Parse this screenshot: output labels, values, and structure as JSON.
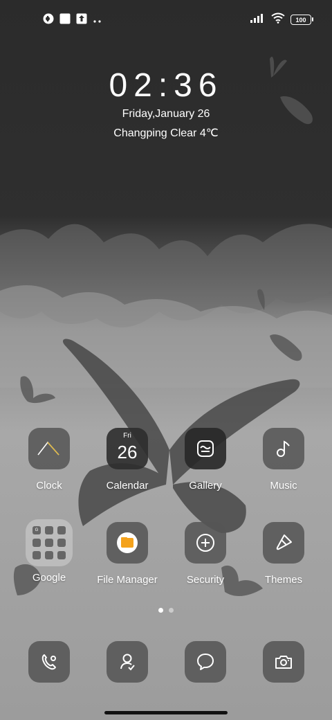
{
  "status_bar": {
    "left_icons": [
      "notification-app-icon",
      "notification-square-icon",
      "notification-upload-icon",
      "more-notifications-icon"
    ],
    "right_icons": [
      "signal-icon",
      "wifi-icon",
      "battery-icon"
    ],
    "battery_level": "100"
  },
  "clock_widget": {
    "time": "02:36",
    "date": "Friday,January 26",
    "weather": "Changping Clear 4℃"
  },
  "apps": [
    {
      "label": "Clock",
      "icon": "clock-icon"
    },
    {
      "label": "Calendar",
      "icon": "calendar-icon",
      "day": "Fri",
      "date": "26"
    },
    {
      "label": "Gallery",
      "icon": "gallery-icon"
    },
    {
      "label": "Music",
      "icon": "music-icon"
    },
    {
      "label": "Google",
      "icon": "folder-icon"
    },
    {
      "label": "File Manager",
      "icon": "file-manager-icon"
    },
    {
      "label": "Security",
      "icon": "security-icon"
    },
    {
      "label": "Themes",
      "icon": "themes-icon"
    }
  ],
  "page_indicator": {
    "pages": 2,
    "current": 1
  },
  "dock": [
    {
      "icon": "phone-icon"
    },
    {
      "icon": "contacts-icon"
    },
    {
      "icon": "messages-icon"
    },
    {
      "icon": "camera-icon"
    }
  ]
}
